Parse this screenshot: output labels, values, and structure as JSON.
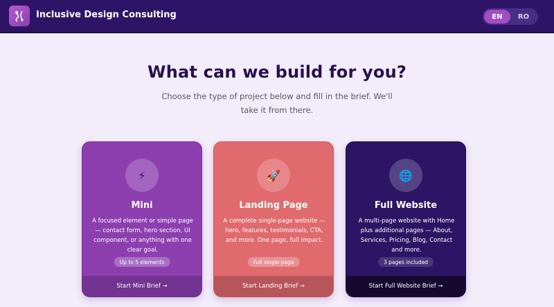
{
  "header": {
    "brand": "Inclusive Design Consulting",
    "logo_icon": "abstract-figure-icon",
    "languages": [
      {
        "code": "EN",
        "active": true
      },
      {
        "code": "RO",
        "active": false
      }
    ]
  },
  "hero": {
    "title": "What can we build for you?",
    "subtitle": "Choose the type of project below and fill in the brief. We'll take it from there."
  },
  "cards": [
    {
      "icon": "⚡",
      "icon_name": "lightning-icon",
      "title": "Mini",
      "description": "A focused element or simple page — contact form, hero section, UI component, or anything with one clear goal.",
      "badge": "Up to 5 elements",
      "cta": "Start Mini Brief →",
      "color": "#8d3fb0"
    },
    {
      "icon": "🚀",
      "icon_name": "rocket-icon",
      "title": "Landing Page",
      "description": "A complete single-page website — hero, features, testimonials, CTA, and more. One page, full impact.",
      "badge": "Full single page",
      "cta": "Start Landing Brief →",
      "color": "#e06a6e"
    },
    {
      "icon": "🌐",
      "icon_name": "globe-icon",
      "title": "Full Website",
      "description": "A multi-page website with Home plus additional pages — About, Services, Pricing, Blog, Contact and more.",
      "badge": "3 pages included",
      "cta": "Start Full Website Brief →",
      "color": "#2c1564"
    }
  ],
  "colors": {
    "header_bg": "#2e1466",
    "page_bg": "#f3ecfb",
    "accent": "#a04fc2"
  }
}
